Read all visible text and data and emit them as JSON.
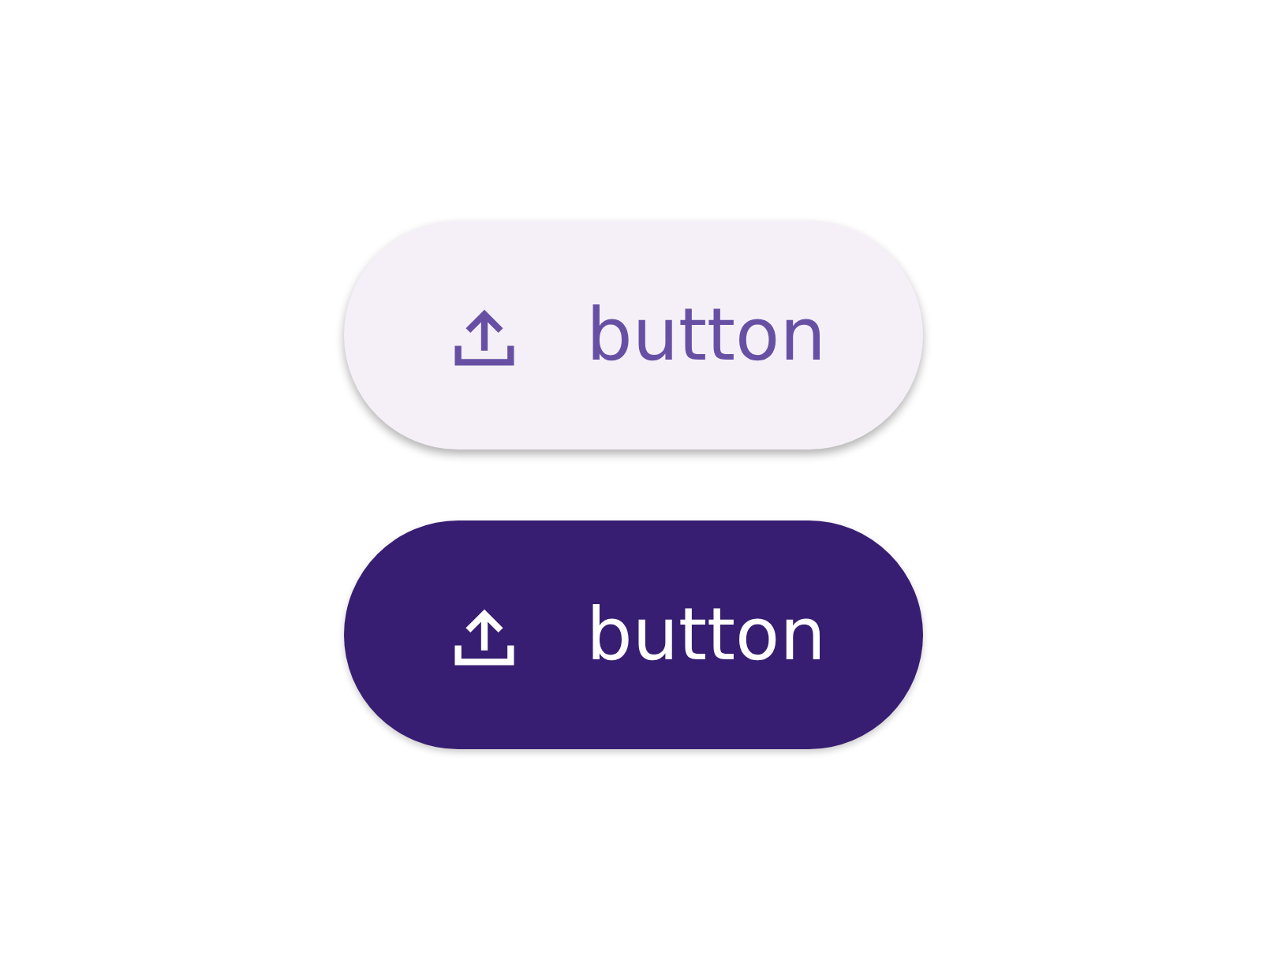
{
  "buttons": [
    {
      "label": "button",
      "kind": "elevated"
    },
    {
      "label": "button",
      "kind": "filled"
    }
  ]
}
